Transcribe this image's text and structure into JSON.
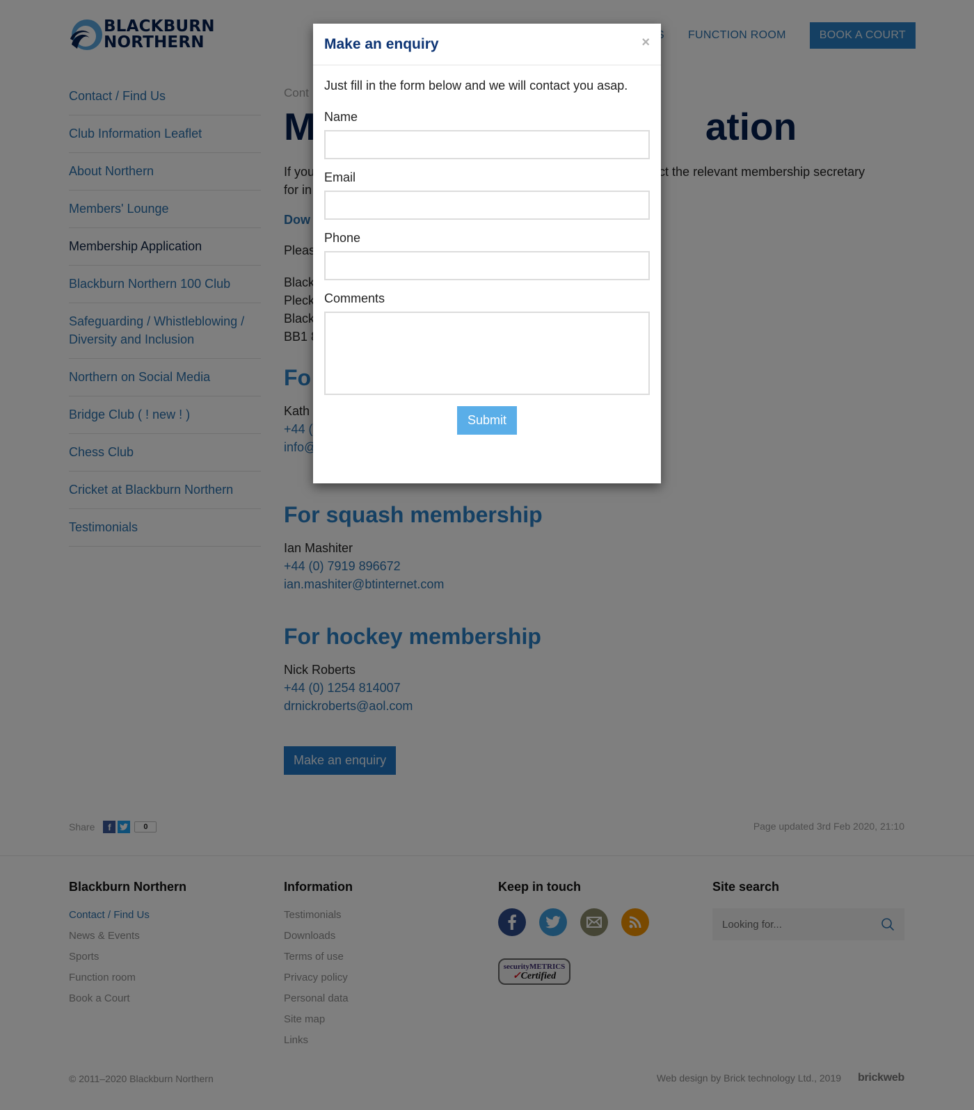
{
  "header": {
    "logo_line1": "BLACKBURN",
    "logo_line2": "NORTHERN",
    "nav": [
      {
        "label": "S"
      },
      {
        "label": "FUNCTION ROOM"
      }
    ],
    "cta_label": "BOOK A COURT"
  },
  "sidebar": {
    "items": [
      {
        "label": "Contact / Find Us"
      },
      {
        "label": "Club Information Leaflet"
      },
      {
        "label": "About Northern"
      },
      {
        "label": "Members' Lounge"
      },
      {
        "label": "Membership Application",
        "active": true
      },
      {
        "label": "Blackburn Northern 100 Club"
      },
      {
        "label": "Safeguarding / Whistleblowing / Diversity and Inclusion"
      },
      {
        "label": "Northern on Social Media"
      },
      {
        "label": "Bridge Club ( ! new ! )"
      },
      {
        "label": "Chess Club"
      },
      {
        "label": "Cricket at Blackburn Northern"
      },
      {
        "label": "Testimonials"
      }
    ]
  },
  "main": {
    "breadcrumb": "Cont",
    "title_start": "M",
    "title_end": "ation",
    "intro_start": "If you",
    "intro_end": "tact the relevant membership secretary",
    "intro_line2": "for in",
    "download": "Dow",
    "please": "Pleas",
    "address": [
      "Black",
      "Pleck",
      "Black",
      "BB1 8"
    ],
    "section1_heading": "Fo",
    "section1_name": "Kath",
    "section1_phone": "+44 (",
    "section1_email": "info@",
    "squash": {
      "heading": "For squash membership",
      "name": "Ian Mashiter",
      "phone": "+44 (0) 7919 896672",
      "email": "ian.mashiter@btinternet.com"
    },
    "hockey": {
      "heading": "For hockey membership",
      "name": "Nick Roberts",
      "phone": "+44 (0) 1254 814007",
      "email": "drnickroberts@aol.com"
    },
    "enquiry_button": "Make an enquiry"
  },
  "share": {
    "label": "Share",
    "facebook_icon": "f",
    "count": "0"
  },
  "updated": "Page updated 3rd Feb 2020, 21:10",
  "footer": {
    "col1": {
      "heading": "Blackburn Northern",
      "links": [
        "Contact / Find Us",
        "News & Events",
        "Sports",
        "Function room",
        "Book a Court"
      ]
    },
    "col2": {
      "heading": "Information",
      "links": [
        "Testimonials",
        "Downloads",
        "Terms of use",
        "Privacy policy",
        "Personal data",
        "Site map",
        "Links"
      ]
    },
    "col3": {
      "heading": "Keep in touch",
      "badge_top": "securityMETRICS",
      "badge_check": "✓",
      "badge_bottom": "Certified"
    },
    "col4": {
      "heading": "Site search",
      "search_placeholder": "Looking for..."
    },
    "copyright": "© 2011–2020  Blackburn Northern",
    "credit": "Web design by Brick technology Ltd., 2019",
    "credit_logo": "brickweb"
  },
  "modal": {
    "title": "Make an enquiry",
    "close": "×",
    "intro": "Just fill in the form below and we will contact you asap.",
    "fields": {
      "name_label": "Name",
      "name_value": "",
      "email_label": "Email",
      "email_value": "",
      "phone_label": "Phone",
      "phone_value": "",
      "comments_label": "Comments",
      "comments_value": ""
    },
    "submit": "Submit"
  },
  "colors": {
    "brand_navy": "#041e4f",
    "link_blue": "#2a71ad",
    "button_blue": "#2177c4",
    "submit_blue": "#5aaee8",
    "overlay": "rgba(0,0,0,0.5)"
  }
}
